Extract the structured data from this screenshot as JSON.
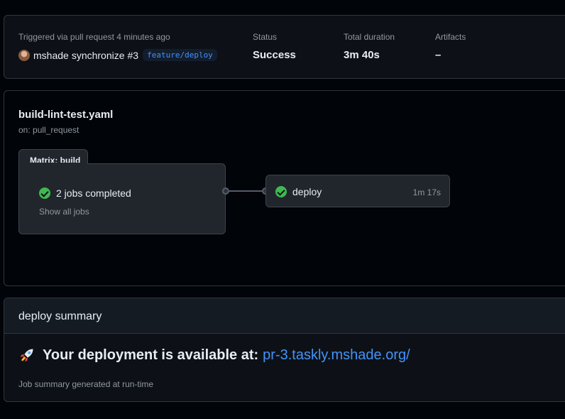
{
  "run_summary": {
    "trigger_text": "Triggered via pull request 4 minutes ago",
    "actor": "mshade",
    "event": "synchronize",
    "pr_number": "#3",
    "branch": "feature/deploy",
    "status_label": "Status",
    "status_value": "Success",
    "duration_label": "Total duration",
    "duration_value": "3m 40s",
    "artifacts_label": "Artifacts",
    "artifacts_value": "–"
  },
  "workflow": {
    "file": "build-lint-test.yaml",
    "trigger": "on: pull_request",
    "matrix_label": "Matrix: build",
    "matrix_jobs_text": "2 jobs completed",
    "show_all_label": "Show all jobs",
    "deploy_job": {
      "name": "deploy",
      "duration": "1m 17s"
    }
  },
  "deploy_summary": {
    "title": "deploy summary",
    "headline": "Your deployment is available at:",
    "link": "pr-3.taskly.mshade.org/",
    "footer": "Job summary generated at run-time"
  },
  "colors": {
    "success": "#3fb950",
    "link": "#4493f8",
    "background": "#010409",
    "card": "#0d1117"
  },
  "icons": {
    "success": "check-circle-icon",
    "rocket": "rocket-icon",
    "avatar": "avatar"
  }
}
